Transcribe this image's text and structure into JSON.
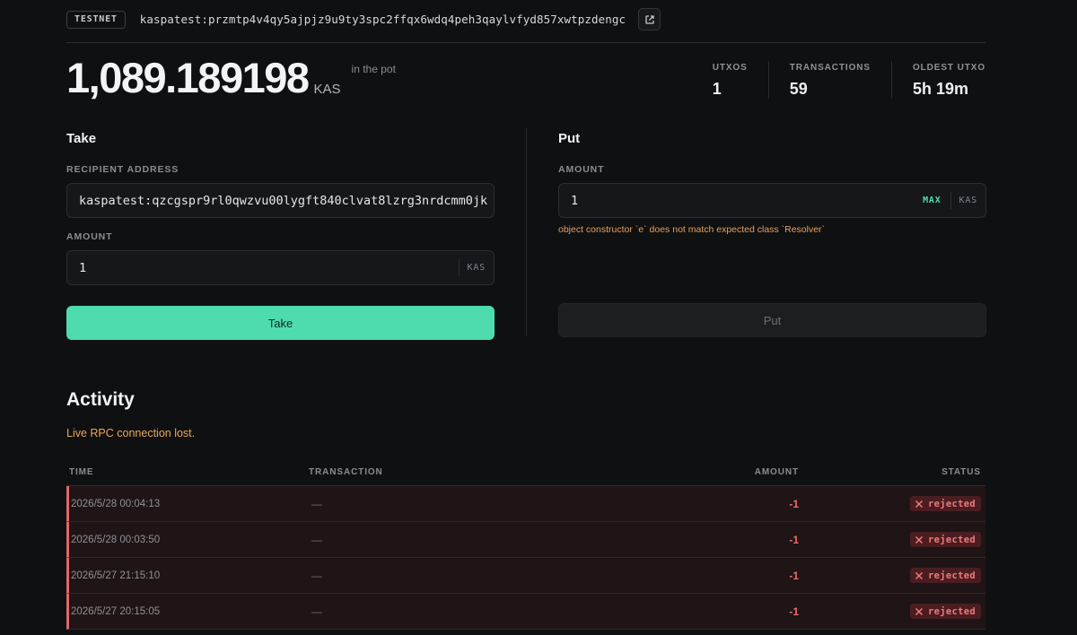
{
  "header": {
    "network": "TESTNET",
    "address": "kaspatest:przmtp4v4qy5ajpjz9u9ty3spc2ffqx6wdq4peh3qaylvfyd857xwtpzdengc"
  },
  "balance": {
    "amount": "1,089.189198",
    "unit": "KAS",
    "note": "in the pot"
  },
  "stats": [
    {
      "label": "UTXOS",
      "value": "1"
    },
    {
      "label": "TRANSACTIONS",
      "value": "59"
    },
    {
      "label": "OLDEST UTXO",
      "value": "5h 19m"
    }
  ],
  "take": {
    "title": "Take",
    "recipient_label": "RECIPIENT ADDRESS",
    "recipient_value": "kaspatest:qzcgspr9rl0qwzvu00lygft840clvat8lzrg3nrdcmm0jk",
    "amount_label": "AMOUNT",
    "amount_value": "1",
    "unit": "KAS",
    "button": "Take"
  },
  "put": {
    "title": "Put",
    "amount_label": "AMOUNT",
    "amount_value": "1",
    "max_label": "MAX",
    "unit": "KAS",
    "error": "object constructor `e` does not match expected class `Resolver`",
    "button": "Put"
  },
  "activity": {
    "title": "Activity",
    "warning": "Live RPC connection lost.",
    "columns": {
      "time": "TIME",
      "transaction": "TRANSACTION",
      "amount": "AMOUNT",
      "status": "STATUS"
    },
    "rows": [
      {
        "time": "2026/5/28 00:04:13",
        "tx": "—",
        "amount": "-1",
        "status": "rejected"
      },
      {
        "time": "2026/5/28 00:03:50",
        "tx": "—",
        "amount": "-1",
        "status": "rejected"
      },
      {
        "time": "2026/5/27 21:15:10",
        "tx": "—",
        "amount": "-1",
        "status": "rejected"
      },
      {
        "time": "2026/5/27 20:15:05",
        "tx": "—",
        "amount": "-1",
        "status": "rejected"
      }
    ]
  },
  "colors": {
    "accent": "#4edcae",
    "error": "#ee6b6b",
    "warning": "#eba65a",
    "background": "#0f1012"
  },
  "icons": {
    "external_link": "external-link-icon",
    "reject": "x-icon"
  }
}
